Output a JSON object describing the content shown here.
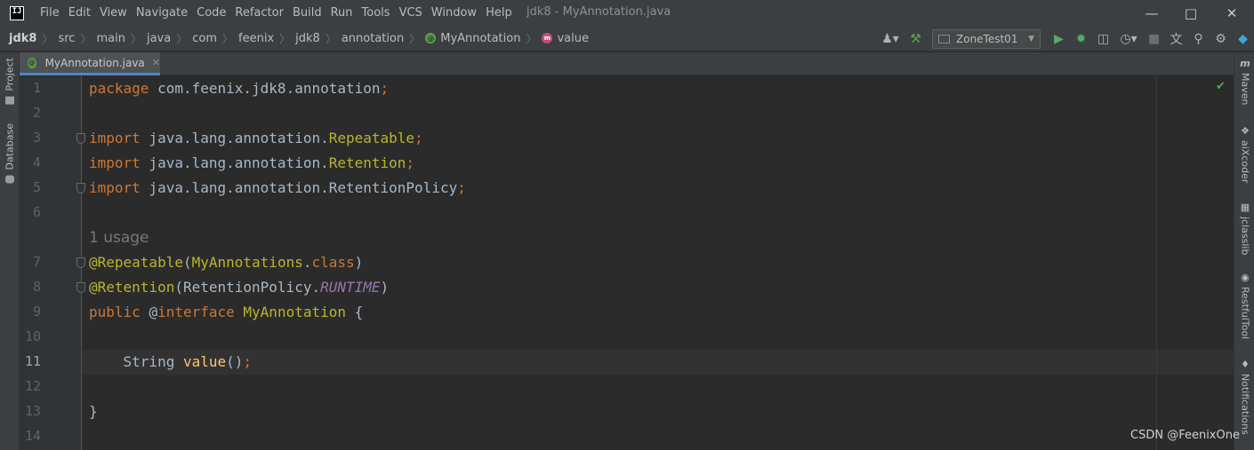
{
  "app": {
    "window_title": "jdk8 - MyAnnotation.java",
    "logo_text": "IJ"
  },
  "menu": [
    "File",
    "Edit",
    "View",
    "Navigate",
    "Code",
    "Refactor",
    "Build",
    "Run",
    "Tools",
    "VCS",
    "Window",
    "Help"
  ],
  "breadcrumb": [
    "jdk8",
    "src",
    "main",
    "java",
    "com",
    "feenix",
    "jdk8",
    "annotation",
    "MyAnnotation",
    "value"
  ],
  "run_config": {
    "name": "ZoneTest01"
  },
  "left_tool_windows": [
    "Project",
    "Database"
  ],
  "right_tool_windows": [
    "Maven",
    "aiXcoder",
    "jclasslib",
    "RestfulTool",
    "Notifications"
  ],
  "editor": {
    "tab_label": "MyAnnotation.java",
    "usage_hint": "1 usage",
    "active_line": 11,
    "lines": [
      {
        "num": "1",
        "tokens": [
          {
            "t": "package",
            "c": "kw"
          },
          {
            "t": " com.feenix.jdk8.annotation",
            "c": "pkg"
          },
          {
            "t": ";",
            "c": "kw"
          }
        ]
      },
      {
        "num": "2",
        "tokens": []
      },
      {
        "num": "3",
        "tokens": [
          {
            "t": "import",
            "c": "kw"
          },
          {
            "t": " java.lang.annotation.",
            "c": "pkg"
          },
          {
            "t": "Repeatable",
            "c": "ann"
          },
          {
            "t": ";",
            "c": "kw"
          }
        ],
        "fold": true
      },
      {
        "num": "4",
        "tokens": [
          {
            "t": "import",
            "c": "kw"
          },
          {
            "t": " java.lang.annotation.",
            "c": "pkg"
          },
          {
            "t": "Retention",
            "c": "ann"
          },
          {
            "t": ";",
            "c": "kw"
          }
        ]
      },
      {
        "num": "5",
        "tokens": [
          {
            "t": "import",
            "c": "kw"
          },
          {
            "t": " java.lang.annotation.RetentionPolicy",
            "c": "pkg"
          },
          {
            "t": ";",
            "c": "kw"
          }
        ],
        "fold": true
      },
      {
        "num": "6",
        "tokens": []
      },
      {
        "num": "7",
        "tokens": [
          {
            "t": "@Repeatable",
            "c": "ann"
          },
          {
            "t": "(",
            "c": "cls"
          },
          {
            "t": "MyAnnotations",
            "c": "ann"
          },
          {
            "t": ".",
            "c": "cls"
          },
          {
            "t": "class",
            "c": "kw"
          },
          {
            "t": ")",
            "c": "cls"
          }
        ],
        "fold": true
      },
      {
        "num": "8",
        "tokens": [
          {
            "t": "@Retention",
            "c": "ann"
          },
          {
            "t": "(RetentionPolicy.",
            "c": "cls"
          },
          {
            "t": "RUNTIME",
            "c": "const"
          },
          {
            "t": ")",
            "c": "cls"
          }
        ],
        "fold": true
      },
      {
        "num": "9",
        "tokens": [
          {
            "t": "public ",
            "c": "kw"
          },
          {
            "t": "@",
            "c": "cls"
          },
          {
            "t": "interface ",
            "c": "kw"
          },
          {
            "t": "MyAnnotation",
            "c": "ann"
          },
          {
            "t": " {",
            "c": "cls"
          }
        ]
      },
      {
        "num": "10",
        "tokens": []
      },
      {
        "num": "11",
        "tokens": [
          {
            "t": "    String ",
            "c": "cls"
          },
          {
            "t": "value",
            "c": "meth"
          },
          {
            "t": "()",
            "c": "cls"
          },
          {
            "t": ";",
            "c": "kw"
          }
        ]
      },
      {
        "num": "12",
        "tokens": []
      },
      {
        "num": "13",
        "tokens": [
          {
            "t": "}",
            "c": "cls"
          }
        ]
      },
      {
        "num": "14",
        "tokens": []
      }
    ]
  },
  "watermark": "CSDN @FeenixOne",
  "colors": {
    "keyword": "#cc7832",
    "annotation": "#bbb529",
    "method": "#ffc66d",
    "constant": "#9876aa",
    "text": "#a9b7c6",
    "background": "#2b2b2b"
  }
}
